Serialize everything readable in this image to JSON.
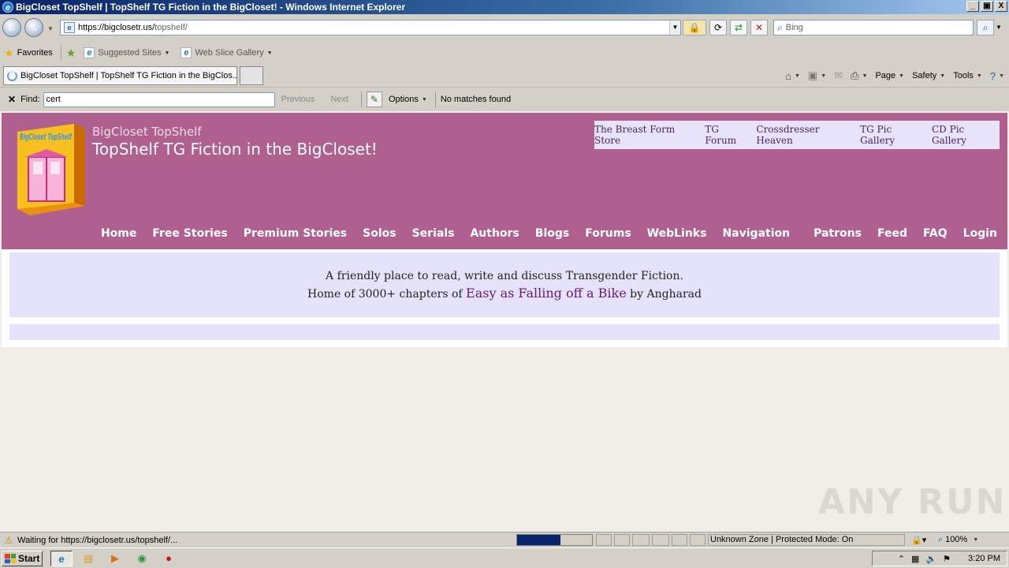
{
  "window": {
    "title": "BigCloset TopShelf | TopShelf TG Fiction in the BigCloset! - Windows Internet Explorer",
    "buttons": [
      "_",
      "▣",
      "X"
    ]
  },
  "address_bar": {
    "url_base": "https://bigclosetr.us/",
    "url_path": "topshelf/",
    "search_placeholder": "Bing"
  },
  "favorites_bar": {
    "favorites_label": "Favorites",
    "links": [
      {
        "label": "Suggested Sites"
      },
      {
        "label": "Web Slice Gallery"
      }
    ]
  },
  "tabs": [
    {
      "label": "BigCloset TopShelf | TopShelf TG Fiction in the BigClos..."
    }
  ],
  "command_bar": {
    "page": "Page",
    "safety": "Safety",
    "tools": "Tools"
  },
  "find_bar": {
    "label": "Find:",
    "value": "cert",
    "previous": "Previous",
    "next": "Next",
    "options": "Options",
    "status": "No matches found"
  },
  "site": {
    "logo_text": "BigCloset TopShelf",
    "subtitle": "BigCloset TopShelf",
    "title": "TopShelf TG Fiction in the BigCloset!",
    "top_links": [
      "The Breast Form Store",
      "TG Forum",
      "Crossdresser Heaven",
      "TG Pic Gallery",
      "CD Pic Gallery"
    ],
    "nav": [
      "Home",
      "Free Stories",
      "Premium Stories",
      "Solos",
      "Serials",
      "Authors",
      "Blogs",
      "Forums",
      "WebLinks",
      "Navigation",
      "Patrons",
      "Feed",
      "FAQ",
      "Login"
    ],
    "intro_line1": "A friendly place to read, write and discuss Transgender Fiction.",
    "intro_line2_prefix": "Home of 3000+ chapters of",
    "intro_book": "Easy as Falling off a Bike",
    "intro_line2_suffix": "by Angharad"
  },
  "watermark": "ANY RUN",
  "status_bar": {
    "text": "Waiting for https://bigclosetr.us/topshelf/...",
    "progress_fraction": 0.58,
    "zone": "Unknown Zone | Protected Mode: On",
    "zoom": "100%"
  },
  "taskbar": {
    "start": "Start",
    "clock": "3:20 PM"
  },
  "colors": {
    "header": "#b0608e",
    "panel": "#e5e3fb",
    "link": "#6a1a80"
  }
}
